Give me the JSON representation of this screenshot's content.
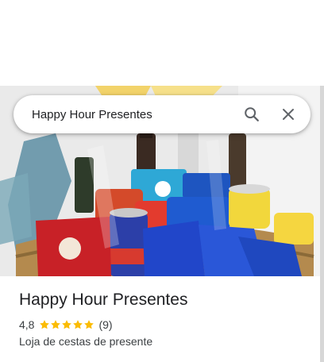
{
  "search": {
    "value": "Happy Hour Presentes"
  },
  "hero": {
    "image_icon": "gift-basket-photo"
  },
  "place": {
    "name": "Happy Hour Presentes",
    "rating": "4,8",
    "stars": 5,
    "review_count": "(9)",
    "category": "Loja de cestas de presente"
  },
  "icons": {
    "search": "search-icon",
    "close": "close-icon",
    "star": "star-icon"
  },
  "colors": {
    "star": "#fbbc04",
    "text_primary": "#202124",
    "text_secondary": "#3c4043",
    "icon": "#5f6368"
  }
}
